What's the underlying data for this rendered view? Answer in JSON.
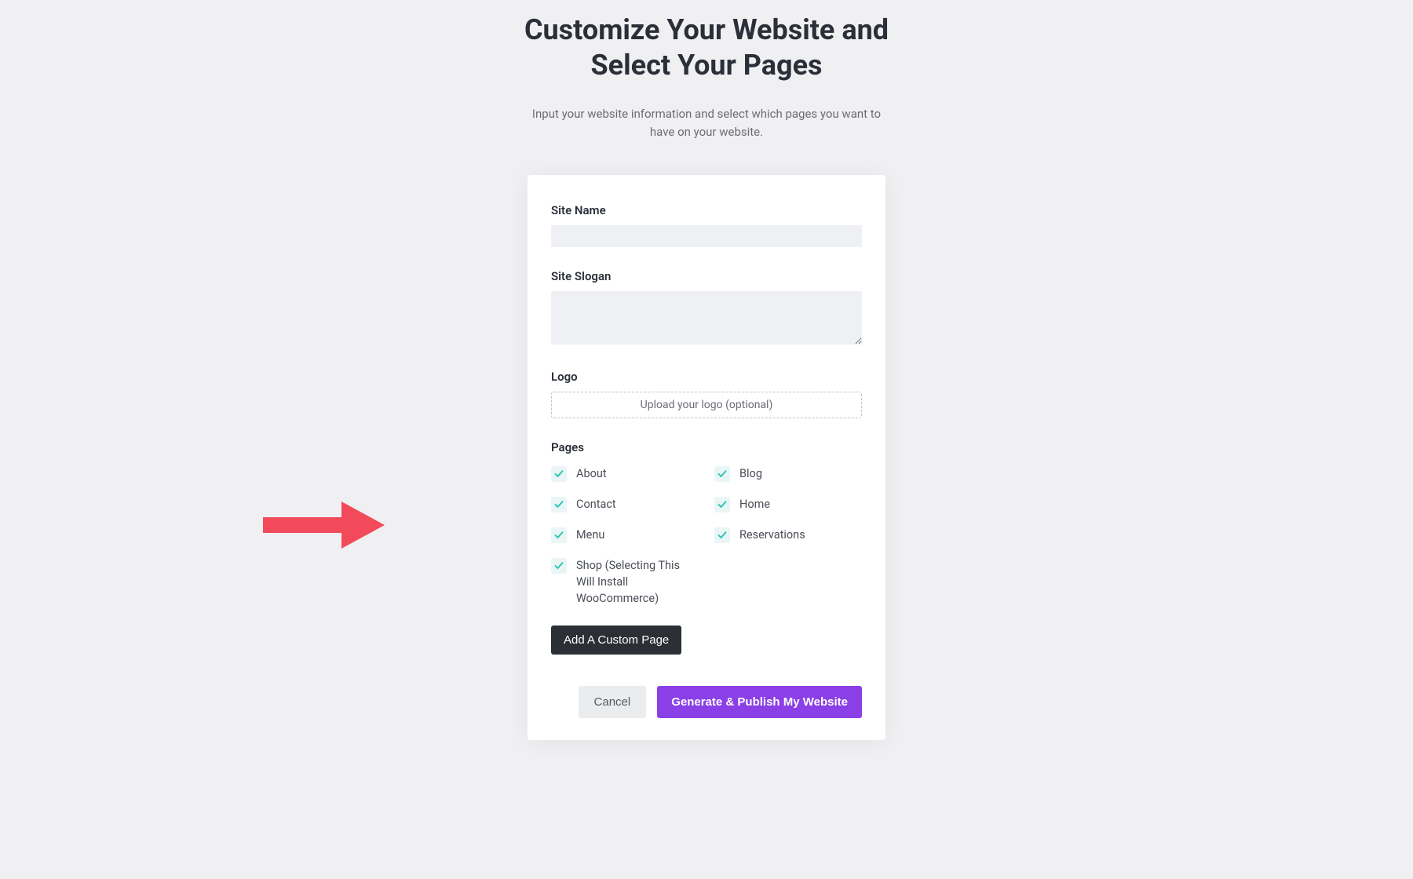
{
  "header": {
    "title_line1": "Customize Your Website and",
    "title_line2": "Select Your Pages",
    "subtitle": "Input your website information and select which pages you want to have on your website."
  },
  "form": {
    "site_name": {
      "label": "Site Name",
      "value": ""
    },
    "site_slogan": {
      "label": "Site Slogan",
      "value": ""
    },
    "logo": {
      "label": "Logo",
      "upload_text": "Upload your logo (optional)"
    },
    "pages_label": "Pages",
    "pages": [
      {
        "label": "About",
        "checked": true
      },
      {
        "label": "Blog",
        "checked": true
      },
      {
        "label": "Contact",
        "checked": true
      },
      {
        "label": "Home",
        "checked": true
      },
      {
        "label": "Menu",
        "checked": true
      },
      {
        "label": "Reservations",
        "checked": true
      },
      {
        "label": "Shop (Selecting This Will Install WooCommerce)",
        "checked": true
      }
    ],
    "add_page_label": "Add A Custom Page"
  },
  "actions": {
    "cancel": "Cancel",
    "submit": "Generate & Publish My Website"
  },
  "colors": {
    "accent": "#8b3fe6",
    "check": "#22c4b4",
    "arrow": "#f24a5a"
  }
}
